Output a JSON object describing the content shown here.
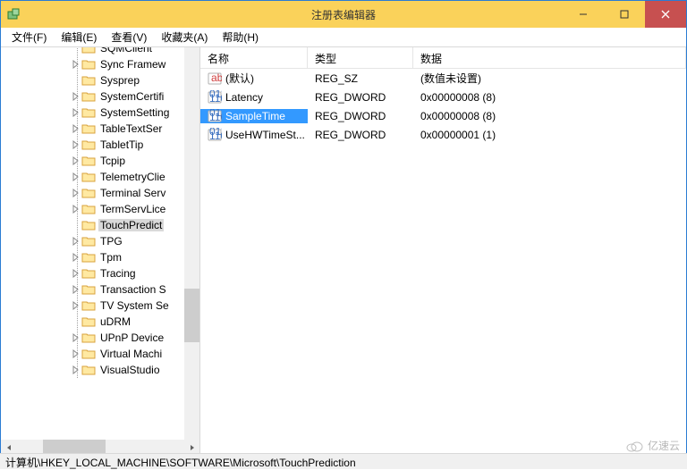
{
  "title": "注册表编辑器",
  "menu": [
    "文件(F)",
    "编辑(E)",
    "查看(V)",
    "收藏夹(A)",
    "帮助(H)"
  ],
  "tree": [
    {
      "label": "SQMClient",
      "sel": false
    },
    {
      "label": "Sync Framew",
      "sel": false,
      "exp": true
    },
    {
      "label": "Sysprep",
      "sel": false
    },
    {
      "label": "SystemCertifi",
      "sel": false,
      "exp": true
    },
    {
      "label": "SystemSetting",
      "sel": false,
      "exp": true
    },
    {
      "label": "TableTextSer",
      "sel": false,
      "exp": true
    },
    {
      "label": "TabletTip",
      "sel": false,
      "exp": true
    },
    {
      "label": "Tcpip",
      "sel": false,
      "exp": true
    },
    {
      "label": "TelemetryClie",
      "sel": false,
      "exp": true
    },
    {
      "label": "Terminal Serv",
      "sel": false,
      "exp": true
    },
    {
      "label": "TermServLice",
      "sel": false,
      "exp": true
    },
    {
      "label": "TouchPredict",
      "sel": true
    },
    {
      "label": "TPG",
      "sel": false,
      "exp": true
    },
    {
      "label": "Tpm",
      "sel": false,
      "exp": true
    },
    {
      "label": "Tracing",
      "sel": false,
      "exp": true
    },
    {
      "label": "Transaction S",
      "sel": false,
      "exp": true
    },
    {
      "label": "TV System Se",
      "sel": false,
      "exp": true
    },
    {
      "label": "uDRM",
      "sel": false
    },
    {
      "label": "UPnP Device",
      "sel": false,
      "exp": true
    },
    {
      "label": "Virtual Machi",
      "sel": false,
      "exp": true
    },
    {
      "label": "VisualStudio",
      "sel": false,
      "exp": true
    }
  ],
  "columns": {
    "name": "名称",
    "type": "类型",
    "data": "数据"
  },
  "values": [
    {
      "icon": "str",
      "name": "(默认)",
      "type": "REG_SZ",
      "data": "(数值未设置)",
      "sel": false
    },
    {
      "icon": "bin",
      "name": "Latency",
      "type": "REG_DWORD",
      "data": "0x00000008 (8)",
      "sel": false
    },
    {
      "icon": "bin",
      "name": "SampleTime",
      "type": "REG_DWORD",
      "data": "0x00000008 (8)",
      "sel": true
    },
    {
      "icon": "bin",
      "name": "UseHWTimeSt...",
      "type": "REG_DWORD",
      "data": "0x00000001 (1)",
      "sel": false
    }
  ],
  "statusbar": "计算机\\HKEY_LOCAL_MACHINE\\SOFTWARE\\Microsoft\\TouchPrediction",
  "watermark": "亿速云"
}
